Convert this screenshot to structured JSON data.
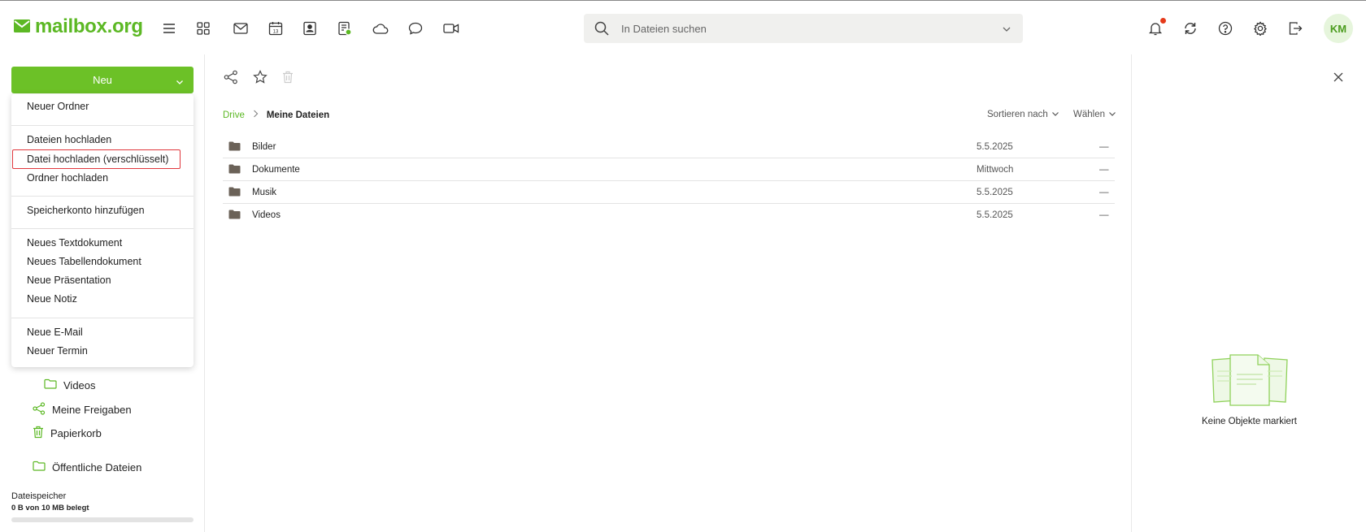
{
  "brand": {
    "name": "mailbox.org",
    "color": "#5cb824"
  },
  "header": {
    "app_icons": [
      "menu-icon",
      "apps-icon",
      "mail-icon",
      "calendar-icon",
      "contacts-icon",
      "tasks-icon",
      "drive-icon",
      "chat-icon",
      "video-icon"
    ],
    "calendar_day": "13",
    "search_placeholder": "In Dateien suchen",
    "right_icons": [
      "bell-icon",
      "refresh-icon",
      "help-icon",
      "settings-icon",
      "logout-icon"
    ],
    "avatar_initials": "KM"
  },
  "sidebar": {
    "new_button": "Neu",
    "items": [
      {
        "label": "Videos",
        "icon": "folder-icon",
        "sub": true
      },
      {
        "label": "Meine Freigaben",
        "icon": "share-icon"
      },
      {
        "label": "Papierkorb",
        "icon": "trash-icon"
      },
      {
        "label": "Öffentliche Dateien",
        "icon": "folder-icon"
      }
    ],
    "storage": {
      "title": "Dateispeicher",
      "usage": "0 B von 10 MB belegt",
      "fraction": 0
    }
  },
  "new_menu": {
    "groups": [
      [
        "Neuer Ordner"
      ],
      [
        "Dateien hochladen",
        "Datei hochladen (verschlüsselt)",
        "Ordner hochladen"
      ],
      [
        "Speicherkonto hinzufügen"
      ],
      [
        "Neues Textdokument",
        "Neues Tabellendokument",
        "Neue Präsentation",
        "Neue Notiz"
      ],
      [
        "Neue E-Mail",
        "Neuer Termin"
      ]
    ],
    "highlighted": "Datei hochladen (verschlüsselt)"
  },
  "main": {
    "toolbar": [
      "share-icon",
      "star-icon",
      "trash-icon"
    ],
    "breadcrumb": {
      "root": "Drive",
      "current": "Meine Dateien"
    },
    "sort_label": "Sortieren nach",
    "select_label": "Wählen",
    "files": [
      {
        "name": "Bilder",
        "date": "5.5.2025",
        "size": "—"
      },
      {
        "name": "Dokumente",
        "date": "Mittwoch",
        "size": "—"
      },
      {
        "name": "Musik",
        "date": "5.5.2025",
        "size": "—"
      },
      {
        "name": "Videos",
        "date": "5.5.2025",
        "size": "—"
      }
    ]
  },
  "detail_panel": {
    "empty_text": "Keine Objekte markiert"
  }
}
